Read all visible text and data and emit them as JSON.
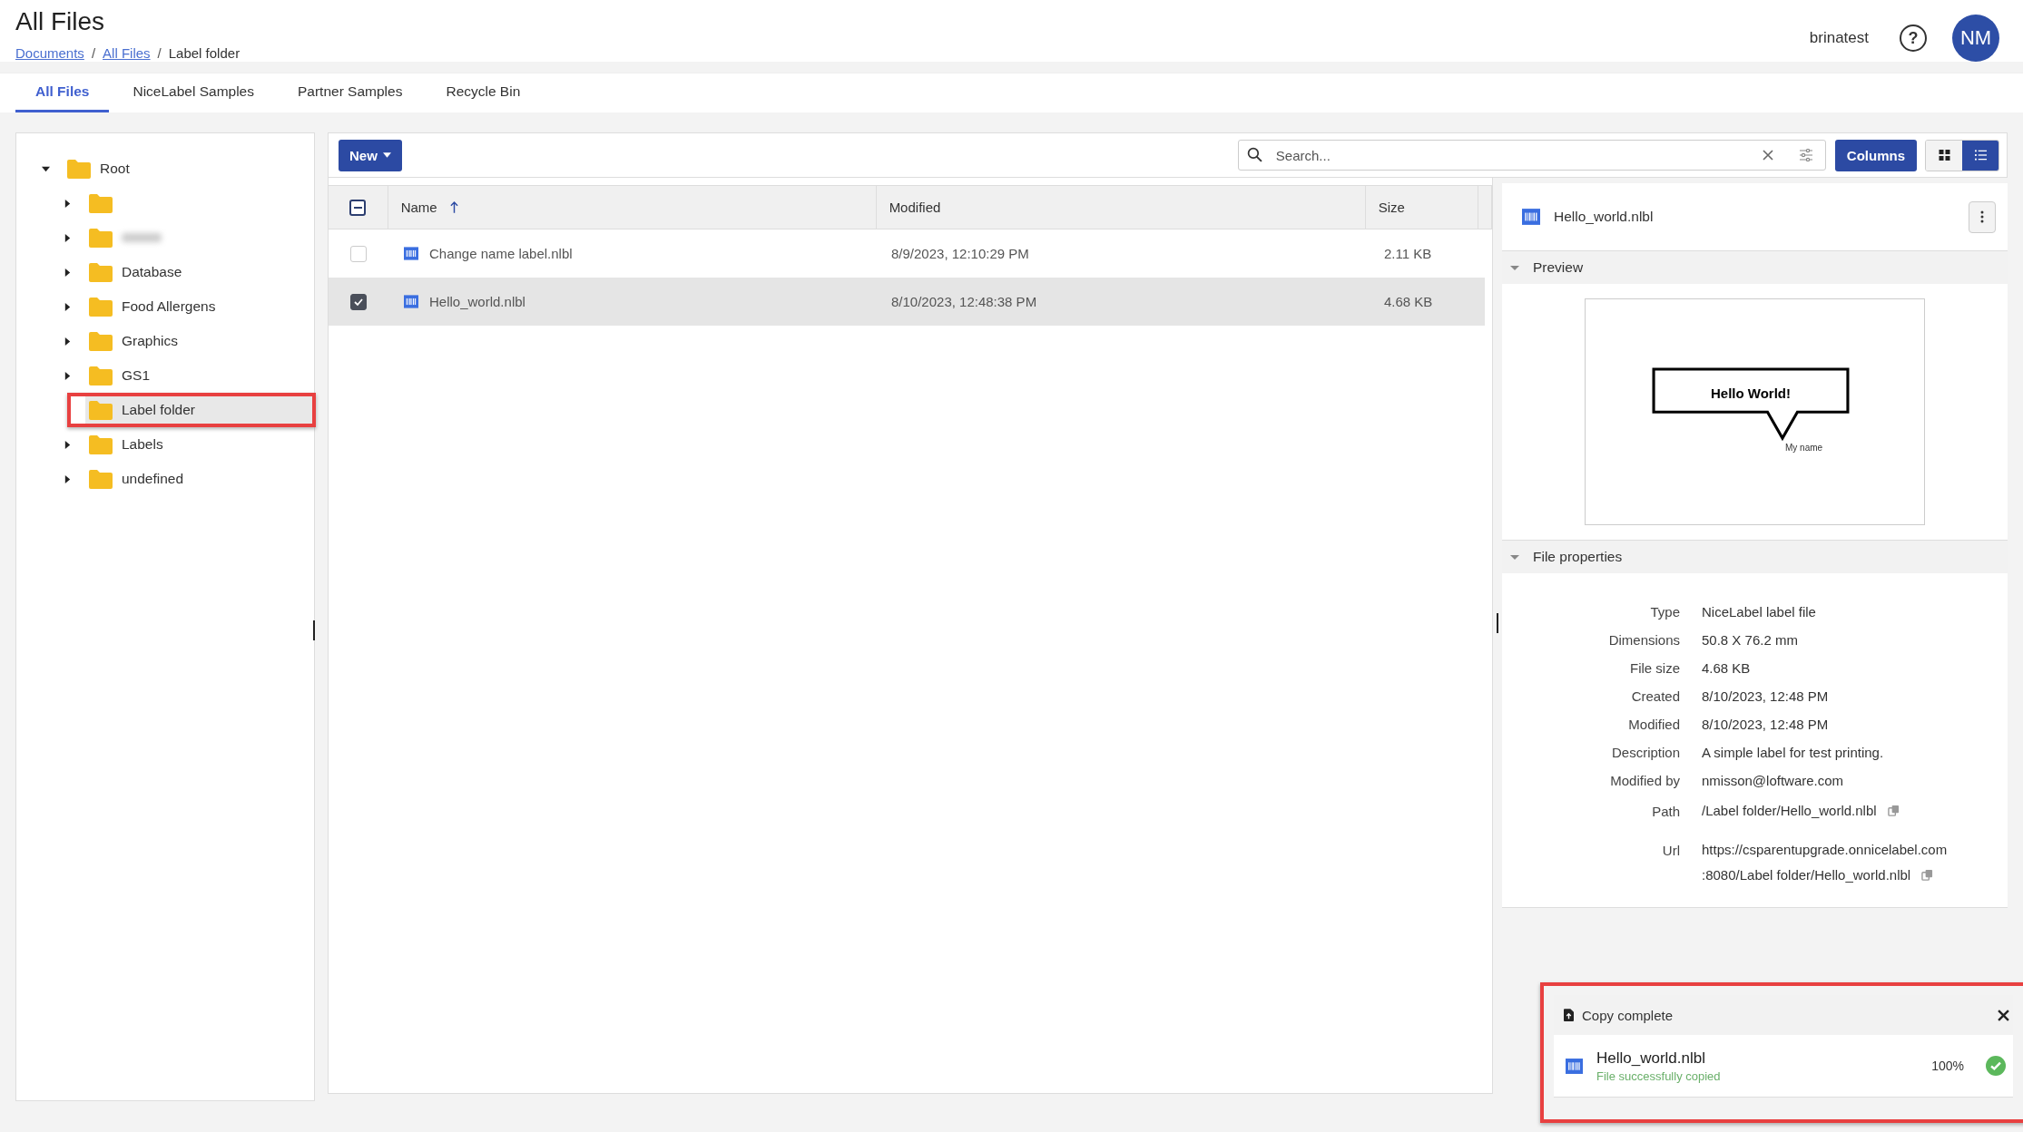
{
  "header": {
    "title": "All Files",
    "breadcrumb": [
      {
        "label": "Documents",
        "link": true
      },
      {
        "sep": "/",
        "label": "All Files",
        "link": true
      },
      {
        "sep": "/",
        "label": "Label folder",
        "link": false
      }
    ],
    "user": "brinatest",
    "help": "?",
    "avatar": "NM"
  },
  "tabs": [
    {
      "label": "All Files",
      "selected": true
    },
    {
      "label": "NiceLabel Samples",
      "selected": false
    },
    {
      "label": "Partner Samples",
      "selected": false
    },
    {
      "label": "Recycle Bin",
      "selected": false
    }
  ],
  "tree": [
    {
      "label": "Root",
      "expanded": true,
      "selected": false,
      "has_children": true,
      "children": [
        {
          "expanded": false,
          "selected": false,
          "has_children": true
        },
        {
          "redacted": true,
          "expanded": false,
          "selected": false,
          "has_children": true
        },
        {
          "label": "Database",
          "expanded": false,
          "selected": false,
          "has_children": true
        },
        {
          "label": "Food Allergens",
          "expanded": false,
          "selected": false,
          "has_children": true
        },
        {
          "label": "Graphics",
          "expanded": false,
          "selected": false,
          "has_children": true
        },
        {
          "label": "GS1",
          "expanded": false,
          "selected": false,
          "has_children": true
        },
        {
          "label": "Label folder",
          "selected": true,
          "highlighted": true,
          "has_children": false
        },
        {
          "label": "Labels",
          "expanded": false,
          "selected": false,
          "has_children": true
        },
        {
          "label": "undefined",
          "expanded": false,
          "selected": false,
          "has_children": true
        }
      ]
    }
  ],
  "toolbar": {
    "new_button": "New",
    "search": {
      "placeholder": "Search..."
    },
    "columns_button": "Columns",
    "view_modes": [
      {
        "kind": "grid",
        "selected": false
      },
      {
        "kind": "list",
        "selected": true
      }
    ]
  },
  "table": {
    "select_all": {
      "indeterminate": true
    },
    "columns": [
      {
        "label": "Name",
        "sorted": true,
        "ascending": true
      },
      {
        "label": "Modified",
        "sorted": false
      },
      {
        "label": "Size",
        "sorted": false
      }
    ],
    "rows": [
      {
        "name": "Change name label.nlbl",
        "modified": "8/9/2023, 12:10:29 PM",
        "size": "2.11 KB",
        "selected": false
      },
      {
        "name": "Hello_world.nlbl",
        "modified": "8/10/2023, 12:48:38 PM",
        "size": "4.68 KB",
        "selected": true
      }
    ]
  },
  "details": {
    "file": "Hello_world.nlbl",
    "preview": {
      "title": "Preview",
      "expanded": true,
      "heading": "Hello World!",
      "caption": "My name"
    },
    "properties": {
      "title": "File properties",
      "expanded": true,
      "items": [
        {
          "label": "Type",
          "lines": [
            "NiceLabel label file"
          ],
          "copyable": false
        },
        {
          "label": "Dimensions",
          "lines": [
            "50.8 X 76.2 mm"
          ],
          "copyable": false
        },
        {
          "label": "File size",
          "lines": [
            "4.68 KB"
          ],
          "copyable": false
        },
        {
          "label": "Created",
          "lines": [
            "8/10/2023, 12:48 PM"
          ],
          "copyable": false
        },
        {
          "label": "Modified",
          "lines": [
            "8/10/2023, 12:48 PM"
          ],
          "copyable": false
        },
        {
          "label": "Description",
          "lines": [
            "A simple label for test printing."
          ],
          "copyable": false
        },
        {
          "label": "Modified by",
          "lines": [
            "nmisson@loftware.com"
          ],
          "copyable": false
        },
        {
          "label": "Path",
          "lines": [
            "/Label folder/Hello_world.nlbl"
          ],
          "copyable": true
        },
        {
          "label": "Url",
          "lines": [
            "https://csparentupgrade.onnicelabel.com",
            ":8080/Label folder/Hello_world.nlbl"
          ],
          "copyable": true
        }
      ]
    }
  },
  "toast": {
    "title": "Copy complete",
    "file": "Hello_world.nlbl",
    "status": "File successfully copied",
    "percent": "100%",
    "done": true,
    "highlighted": true
  }
}
